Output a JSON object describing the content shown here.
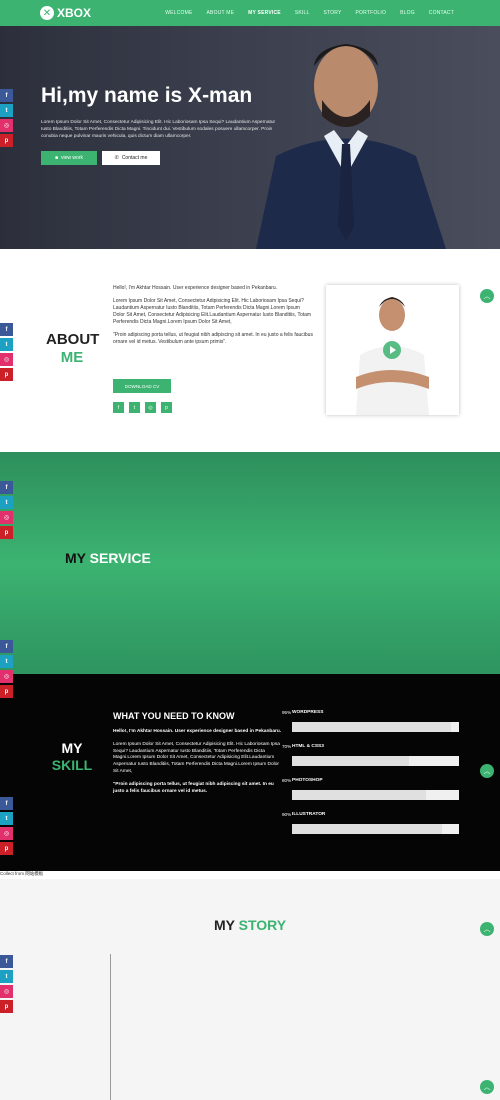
{
  "nav": {
    "logo_text": "XBOX",
    "links": [
      "WELCOME",
      "ABOUT ME",
      "MY SERVICE",
      "SKILL",
      "STORY",
      "PORTFOLIO",
      "BLOG",
      "CONTACT"
    ]
  },
  "hero": {
    "title": "Hi,my name is X-man",
    "text": "Lorem Ipsum Dolor Sit Amet, Consectetur Adipisicing Elit. Hic Laboriosam Ipsa Sequi? Laudantium Aspernatur Iusto Blanditiis, Totam Perferendis Dicta Magni. Tincidunt dui. Vestibulum sodales posuere ullamcorper. Proin conubia neque pulvinar mauris vehicula, quis dictum diam ullamcorper.",
    "btn_work": "view work",
    "btn_contact": "Contact me"
  },
  "about": {
    "title_1": "ABOUT",
    "title_2": "ME",
    "p1": "Hello!, I'm Akhtar Hossain. User experience designer based in Pekanbaru.",
    "p2": "Lorem Ipsum Dolor Sit Amet, Consectetur Adipisicing Elit. Hic Laboriosam Ipsa Sequi? Laudantium Aspernatur Iusto Blanditiis, Totam Perferendis Dicta Magni.Lorem Ipsum Dolor Sit Amet, Consectetur Adipisicing Elit.Laudantium Aspernatur Iusto Blanditiis, Totam Perferendis Dicta Magni.Lorem Ipsum Dolor Sit Amet,",
    "p3": "\"Proin adipiscing porta tellus, ut feugiat nibh adipiscing sit amet. In eu justo a felis faucibus ornare vel id metus. Vestibulum ante ipsum primis\".",
    "btn_cv": "DOWNLOAD CV"
  },
  "service": {
    "title_1": "MY",
    "title_2": "SERVICE"
  },
  "skill": {
    "title_1": "MY",
    "title_2": "SKILL",
    "heading": "WHAT YOU NEED TO KNOW",
    "p1": "Hello!, I'm Akhtar Hossain. User experience designer based in Pekanbaru.",
    "p2": "Lorem Ipsum Dolor Sit Amet, Consectetur Adipisicing Elit. Hic Laboriosam Ipsa Sequi? Laudantium Aspernatur Iusto Blanditiis, Totam Perferendis Dicta Magni.Lorem Ipsum Dolor Sit Amet, Consectetur Adipisicing Elit.Laudantium Aspernatur Iusto Blanditiis, Totam Perferendis Dicta Magni.Lorem Ipsum Dolor Sit Amet,",
    "p3": "\"Proin adipiscing porta tellus, ut feugiat nibh adipiscing sit amet. In eu justo a felis faucibus ornare vel id metus.",
    "bars": [
      {
        "pct": "95%",
        "name": "WORDPRESS",
        "value": 0.95
      },
      {
        "pct": "70%",
        "name": "HTML & CSS3",
        "value": 0.7
      },
      {
        "pct": "80%",
        "name": "PHOTOSHOP",
        "value": 0.8
      },
      {
        "pct": "90%",
        "name": "ILLUSTRATOR",
        "value": 0.9
      }
    ]
  },
  "collect_text": "Collect from 网站模板",
  "story": {
    "title_1": "MY",
    "title_2": "STORY"
  },
  "colors": {
    "accent": "#3cb371",
    "facebook": "#3b5998",
    "twitter": "#1da1c2",
    "instagram": "#e1306c",
    "pinterest": "#cb2027"
  },
  "icons": {
    "social": [
      "facebook-icon",
      "twitter-icon",
      "instagram-icon",
      "pinterest-icon"
    ],
    "scroll_top": "chevron-up-icon"
  }
}
